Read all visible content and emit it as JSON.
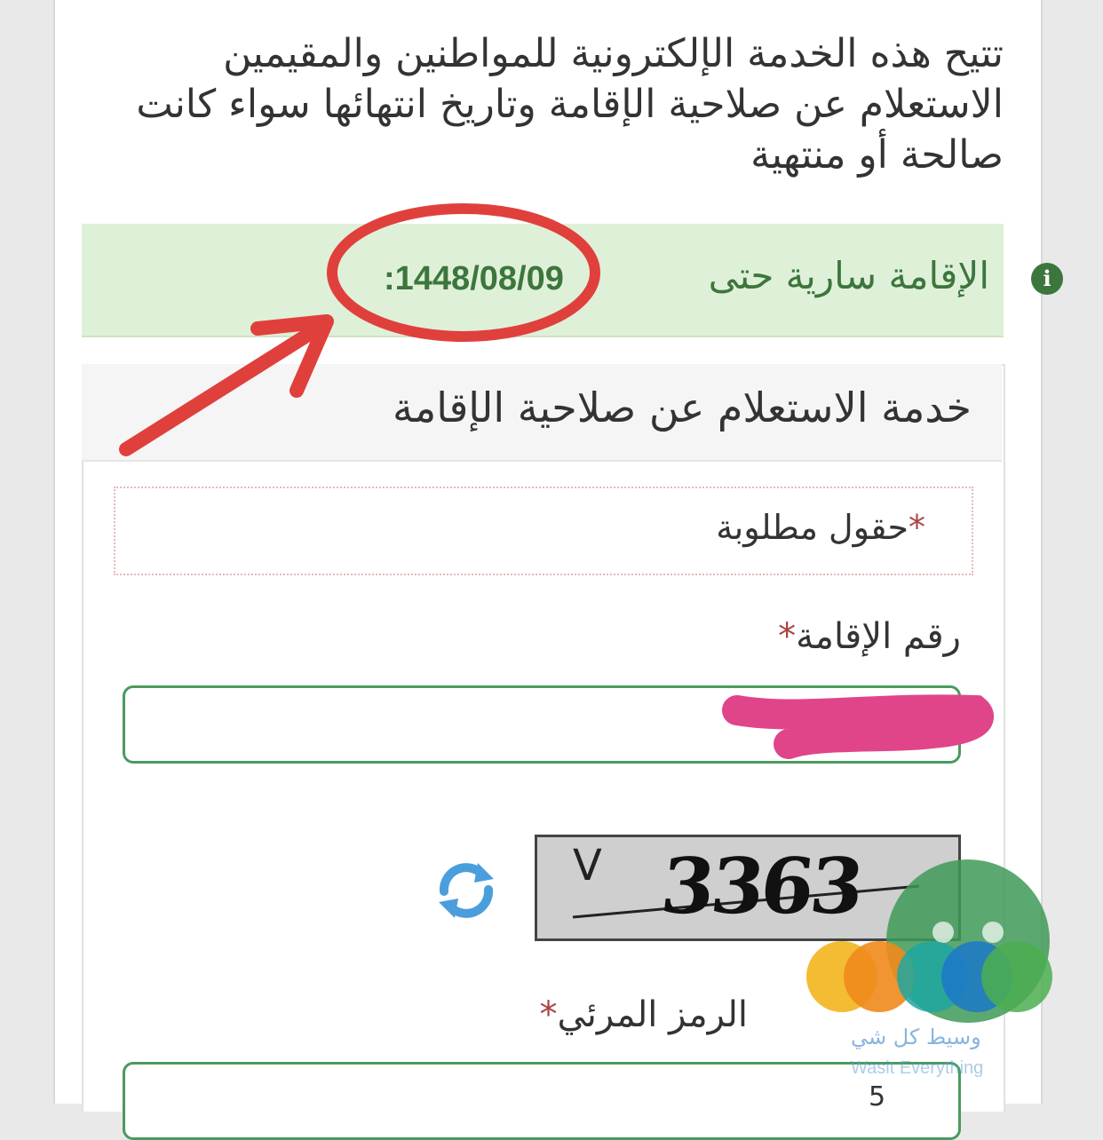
{
  "intro": {
    "text": "تتيح هذه الخدمة الإلكترونية للمواطنين والمقيمين الاستعلام عن صلاحية الإقامة وتاريخ انتهائها سواء كانت صالحة أو منتهية"
  },
  "alert": {
    "icon": "info-icon",
    "text": "الإقامة سارية حتى",
    "date": ":1448/08/09",
    "color": "#3c763d",
    "background": "#dff0d8"
  },
  "panel": {
    "title": "خدمة الاستعلام عن صلاحية الإقامة"
  },
  "form": {
    "required_star": "*",
    "required_note": "حقول مطلوبة",
    "iqama_label": "رقم الإقامة",
    "iqama_star": "*",
    "captcha_code": "3363",
    "captcha_mark": "V",
    "refresh_icon": "refresh-icon",
    "captcha_label": "الرمز المرئي",
    "captcha_star": "*",
    "captcha_value": "5",
    "input_border_color": "#4a9a5e"
  },
  "watermark": {
    "text_ar": "وسيط كل شي",
    "text_en": "Wasit Everything"
  }
}
